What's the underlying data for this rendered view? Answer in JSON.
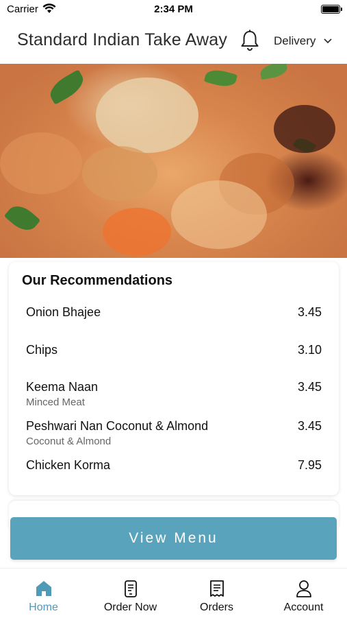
{
  "status_bar": {
    "carrier": "Carrier",
    "time": "2:34 PM"
  },
  "header": {
    "title": "Standard Indian Take Away",
    "delivery_label": "Delivery",
    "icons": [
      "bell-icon",
      "chevron-down-icon"
    ]
  },
  "hero": {
    "image_description": ""
  },
  "recommendations": {
    "title": "Our Recommendations",
    "items": [
      {
        "name": "Onion Bhajee",
        "description": "",
        "price": "3.45"
      },
      {
        "name": "Chips",
        "description": "",
        "price": "3.10"
      },
      {
        "name": "Keema Naan",
        "description": "Minced Meat",
        "price": "3.45"
      },
      {
        "name": "Peshwari Nan Coconut & Almond",
        "description": "Coconut & Almond",
        "price": "3.45"
      },
      {
        "name": "Chicken Korma",
        "description": "",
        "price": "7.95"
      }
    ]
  },
  "view_menu_button": "View Menu",
  "tabbar": {
    "tabs": [
      {
        "label": "Home",
        "icon": "home-icon",
        "active": true
      },
      {
        "label": "Order Now",
        "icon": "order-icon",
        "active": false
      },
      {
        "label": "Orders",
        "icon": "receipt-icon",
        "active": false
      },
      {
        "label": "Account",
        "icon": "account-icon",
        "active": false
      }
    ]
  },
  "colors": {
    "accent": "#5aa3bd",
    "active_tab": "#4f9ab6"
  }
}
